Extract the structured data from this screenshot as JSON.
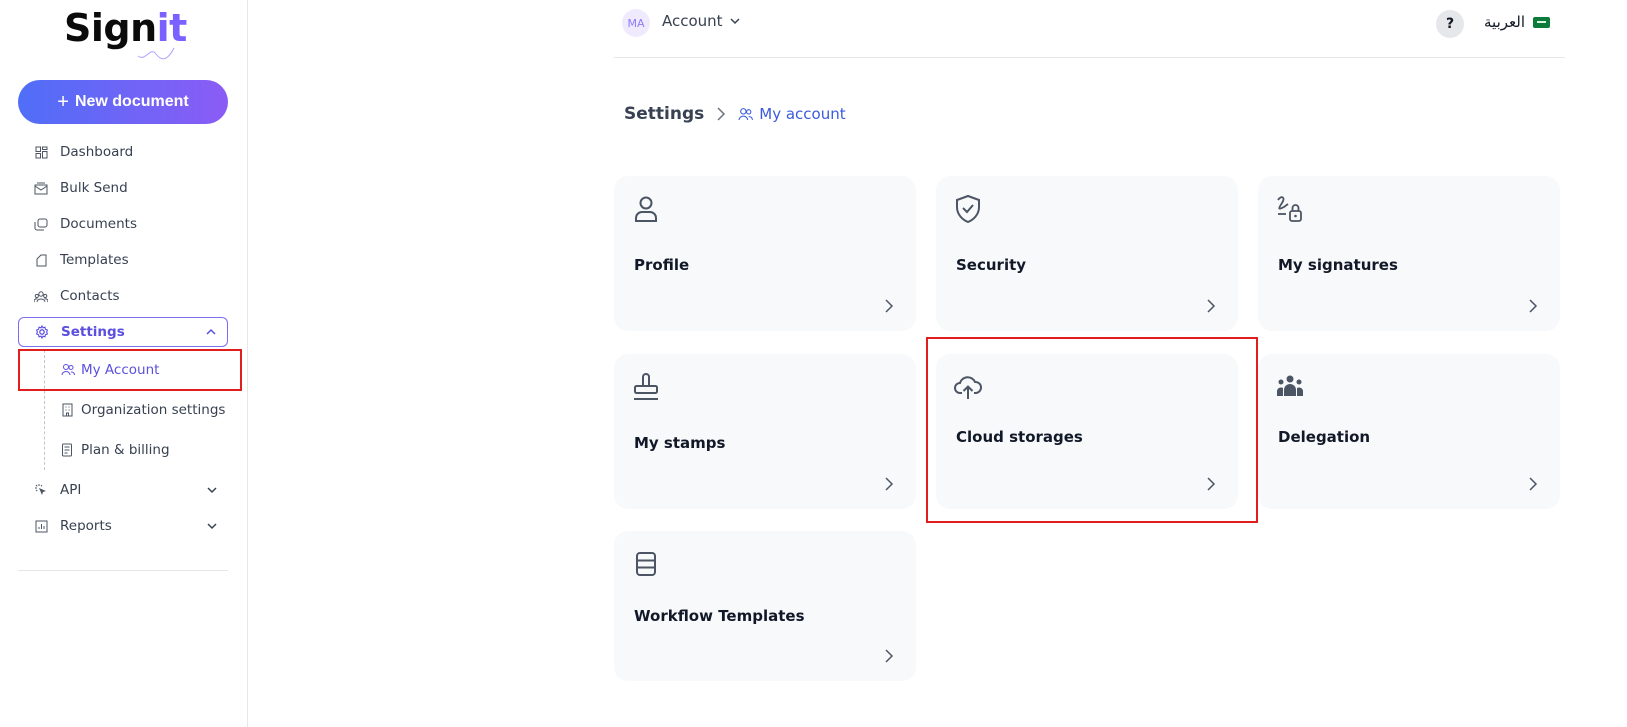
{
  "sidebar": {
    "logo": {
      "main": "Sign",
      "accent": "it"
    },
    "new_document_label": "New document",
    "items": [
      {
        "label": "Dashboard",
        "icon": "dashboard-icon"
      },
      {
        "label": "Bulk Send",
        "icon": "mail-stack-icon"
      },
      {
        "label": "Documents",
        "icon": "documents-icon"
      },
      {
        "label": "Templates",
        "icon": "template-icon"
      },
      {
        "label": "Contacts",
        "icon": "contacts-icon"
      },
      {
        "label": "Settings",
        "icon": "gear-icon",
        "expanded": true
      },
      {
        "label": "API",
        "icon": "cursor-click-icon"
      },
      {
        "label": "Reports",
        "icon": "chart-icon"
      }
    ],
    "settings_sub": [
      {
        "label": "My Account",
        "icon": "users-icon",
        "active": true
      },
      {
        "label": "Organization settings",
        "icon": "building-icon"
      },
      {
        "label": "Plan & billing",
        "icon": "receipt-icon"
      }
    ]
  },
  "topbar": {
    "avatar_initials": "MA",
    "account_label": "Account",
    "help_label": "?",
    "language_label": "العربية"
  },
  "breadcrumb": {
    "root": "Settings",
    "current": "My account"
  },
  "cards": [
    {
      "title": "Profile",
      "icon": "user-icon"
    },
    {
      "title": "Security",
      "icon": "shield-check-icon"
    },
    {
      "title": "My signatures",
      "icon": "signature-lock-icon"
    },
    {
      "title": "My stamps",
      "icon": "stamp-icon"
    },
    {
      "title": "Cloud storages",
      "icon": "cloud-upload-icon"
    },
    {
      "title": "Delegation",
      "icon": "group-icon"
    },
    {
      "title": "Workflow Templates",
      "icon": "stack-icon"
    }
  ],
  "colors": {
    "accent": "#5b4fe0",
    "button_gradient_start": "#4f6ef7",
    "button_gradient_end": "#8b5cf6",
    "highlight": "#e11d1d",
    "card_bg": "#f8f9fb"
  }
}
